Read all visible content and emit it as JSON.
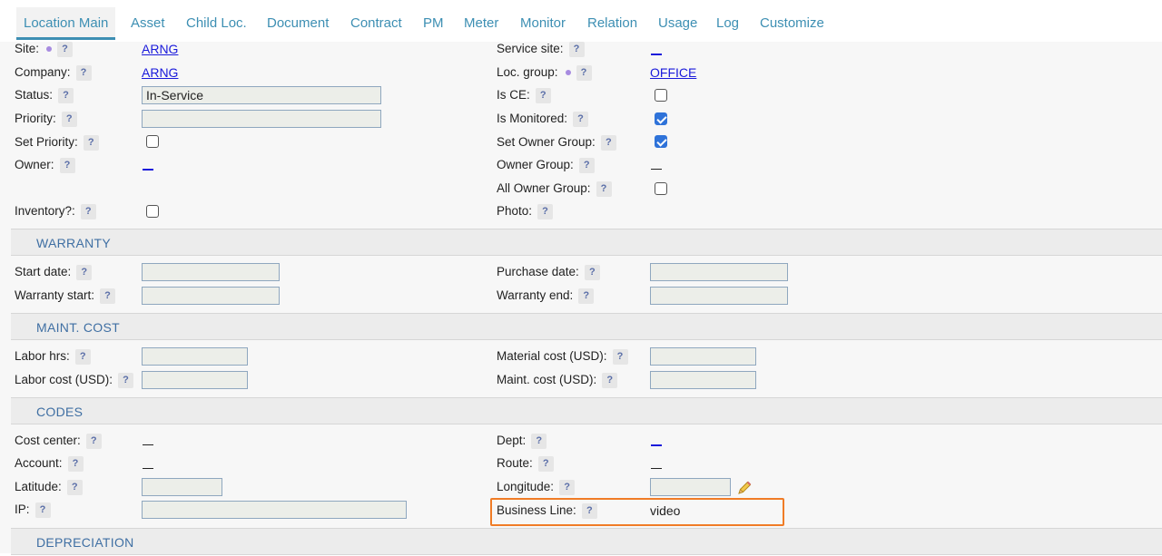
{
  "tabs": [
    {
      "label": "Location Main",
      "active": true
    },
    {
      "label": "Asset"
    },
    {
      "label": "Child Loc."
    },
    {
      "label": "Document"
    },
    {
      "label": "Contract"
    },
    {
      "label": "PM"
    },
    {
      "label": "Meter"
    },
    {
      "label": "Monitor"
    },
    {
      "label": "Relation"
    },
    {
      "label": "Usage"
    },
    {
      "label": "Log"
    },
    {
      "label": "Customize"
    }
  ],
  "help_glyph": "?",
  "general": {
    "site": {
      "label": "Site:",
      "value": "ARNG"
    },
    "company": {
      "label": "Company:",
      "value": "ARNG"
    },
    "status": {
      "label": "Status:",
      "value": "In-Service"
    },
    "priority": {
      "label": "Priority:",
      "value": ""
    },
    "set_priority": {
      "label": "Set Priority:",
      "checked": false
    },
    "owner": {
      "label": "Owner:"
    },
    "inventory": {
      "label": "Inventory?:",
      "checked": false
    },
    "service_site": {
      "label": "Service site:"
    },
    "loc_group": {
      "label": "Loc. group:",
      "value": "OFFICE"
    },
    "is_ce": {
      "label": "Is CE:",
      "checked": false
    },
    "is_monitored": {
      "label": "Is Monitored:",
      "checked": true
    },
    "set_owner_group": {
      "label": "Set Owner Group:",
      "checked": true
    },
    "owner_group": {
      "label": "Owner Group:"
    },
    "all_owner_group": {
      "label": "All Owner Group:",
      "checked": false
    },
    "photo": {
      "label": "Photo:"
    }
  },
  "warranty": {
    "title": "WARRANTY",
    "start_date": {
      "label": "Start date:",
      "value": ""
    },
    "warranty_start": {
      "label": "Warranty start:",
      "value": ""
    },
    "purchase_date": {
      "label": "Purchase date:",
      "value": ""
    },
    "warranty_end": {
      "label": "Warranty end:",
      "value": ""
    }
  },
  "maint_cost": {
    "title": "MAINT. COST",
    "labor_hrs": {
      "label": "Labor hrs:",
      "value": ""
    },
    "labor_cost": {
      "label": "Labor cost (USD):",
      "value": ""
    },
    "material_cost": {
      "label": "Material cost (USD):",
      "value": ""
    },
    "maint_cost": {
      "label": "Maint. cost (USD):",
      "value": ""
    }
  },
  "codes": {
    "title": "CODES",
    "cost_center": {
      "label": "Cost center:"
    },
    "account": {
      "label": "Account:"
    },
    "latitude": {
      "label": "Latitude:",
      "value": ""
    },
    "ip": {
      "label": "IP:",
      "value": ""
    },
    "dept": {
      "label": "Dept:"
    },
    "route": {
      "label": "Route:"
    },
    "longitude": {
      "label": "Longitude:",
      "value": ""
    },
    "business_line": {
      "label": "Business Line:",
      "value": "video"
    }
  },
  "depreciation": {
    "title": "DEPRECIATION"
  },
  "colors": {
    "accent": "#3d8fb3",
    "link": "#1a1adb",
    "highlight": "#f07c26",
    "required_dot": "#a78be0",
    "checkbox_checked": "#2f73d9"
  },
  "icons": {
    "help": "question-mark-icon",
    "required": "required-dot-icon",
    "edit": "pencil-icon"
  }
}
